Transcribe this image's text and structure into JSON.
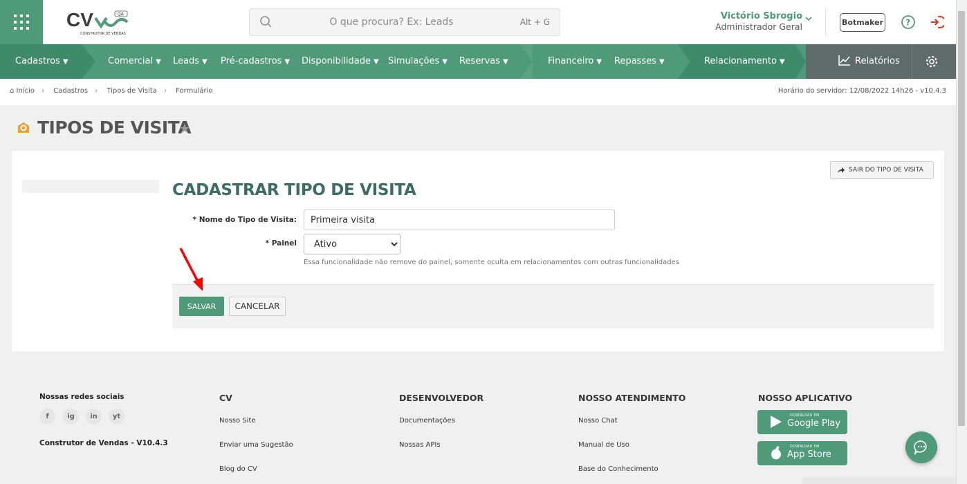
{
  "search": {
    "placeholder": "O que procura? Ex: Leads",
    "shortcut": "Alt + G"
  },
  "logo": {
    "text": "CV",
    "badge": "QA",
    "subtitle": "CONSTRUTOR DE VENDAS"
  },
  "user": {
    "name": "Victório Sbrogio",
    "role": "Administrador Geral"
  },
  "botmaker_label": "Botmaker",
  "nav": {
    "items": [
      "Cadastros",
      "Comercial",
      "Leads",
      "Pré-cadastros",
      "Disponibilidade",
      "Simulações",
      "Reservas",
      "Financeiro",
      "Repasses",
      "Relacionamento"
    ],
    "reports": "Relatórios"
  },
  "breadcrumb": {
    "items": [
      "Início",
      "Cadastros",
      "Tipos de Visita",
      "Formulário"
    ],
    "server_time": "Horário do servidor: 12/08/2022 14h26 - v10.4.3"
  },
  "page": {
    "title": "TIPOS DE VISITA",
    "exit_label": "SAIR DO TIPO DE VISITA"
  },
  "form": {
    "title": "CADASTRAR TIPO DE VISITA",
    "name_label": "* Nome do Tipo de Visita:",
    "name_value": "Primeira visita",
    "panel_label": "* Painel",
    "panel_value": "Ativo",
    "panel_help": "Essa funcionalidade não remove do painel, somente oculta em relacionamentos com outras funcionalidades",
    "save_label": "SALVAR",
    "cancel_label": "CANCELAR"
  },
  "footer": {
    "social_title": "Nossas redes sociais",
    "social_icons": [
      "f",
      "ig",
      "in",
      "yt"
    ],
    "version": "Construtor de Vendas - V10.4.3",
    "cols": [
      {
        "title": "CV",
        "links": [
          "Nosso Site",
          "Enviar uma Sugestão",
          "Blog do CV"
        ]
      },
      {
        "title": "DESENVOLVEDOR",
        "links": [
          "Documentações",
          "Nossas APIs"
        ]
      },
      {
        "title": "NOSSO ATENDIMENTO",
        "links": [
          "Nosso Chat",
          "Manual de Uso",
          "Base do Conhecimento"
        ]
      },
      {
        "title": "NOSSO APLICATIVO",
        "links": []
      }
    ],
    "store_small": "DOWNLOAD EM",
    "google": "Google Play",
    "apple": "App Store"
  },
  "colors": {
    "brand": "#4f9a78",
    "nav_dark": "#3f8a6a",
    "title": "#3d6b66"
  }
}
